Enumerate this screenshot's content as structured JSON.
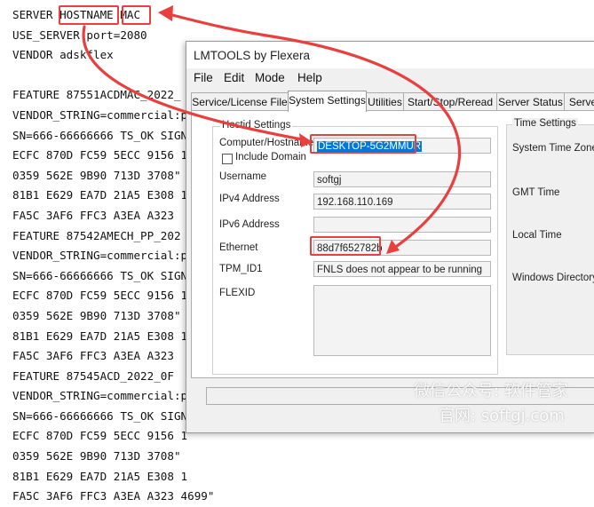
{
  "license_lines": [
    "SERVER HOSTNAME MAC",
    "USE_SERVER port=2080",
    "VENDOR adskflex",
    "",
    "FEATURE 87551ACDMAC_2022_",
    "VENDOR_STRING=commercial:p",
    "SN=666-66666666 TS_OK SIGN",
    "ECFC 870D FC59 5ECC 9156 1",
    "0359 562E 9B90 713D 3708\" ",
    "81B1 E629 EA7D 21A5 E308 1",
    "FA5C 3AF6 FFC3 A3EA A323 ",
    "FEATURE 87542AMECH_PP_202",
    "VENDOR_STRING=commercial:p",
    "SN=666-66666666 TS_OK SIGN",
    "ECFC 870D FC59 5ECC 9156 1",
    "0359 562E 9B90 713D 3708\" ",
    "81B1 E629 EA7D 21A5 E308 1",
    "FA5C 3AF6 FFC3 A3EA A323 ",
    "FEATURE 87545ACD_2022_0F",
    "VENDOR_STRING=commercial:p",
    "SN=666-66666666 TS_OK SIGN",
    "ECFC 870D FC59 5ECC 9156 1",
    "0359 562E 9B90 713D 3708\" ",
    "81B1 E629 EA7D 21A5 E308 1",
    "FA5C 3AF6 FFC3 A3EA A323 4699\""
  ],
  "window": {
    "title": "LMTOOLS by Flexera",
    "menu": [
      "File",
      "Edit",
      "Mode",
      "Help"
    ],
    "tabs": [
      "Service/License File",
      "System Settings",
      "Utilities",
      "Start/Stop/Reread",
      "Server Status",
      "Server"
    ],
    "active_tab": "System Settings"
  },
  "hostid": {
    "group_label": "Hostid Settings",
    "computer_label": "Computer/Hostname",
    "computer_value": "DESKTOP-5G2MMUR",
    "include_domain_label": "Include Domain",
    "username_label": "Username",
    "username_value": "softgj",
    "ipv4_label": "IPv4 Address",
    "ipv4_value": "192.168.110.169",
    "ipv6_label": "IPv6 Address",
    "ipv6_value": "",
    "ethernet_label": "Ethernet",
    "ethernet_value": "88d7f652782b",
    "tpm_label": "TPM_ID1",
    "tpm_value": "FNLS does not appear to be running",
    "flexid_label": "FLEXID"
  },
  "time_settings": {
    "group_label": "Time Settings",
    "system_tz_label": "System Time Zone",
    "gmt_label": "GMT Time",
    "local_label": "Local Time",
    "windir_label": "Windows Directory"
  },
  "watermark": {
    "line1": "微信公众号: 软件管家",
    "line2": "官网: softgj.com"
  },
  "colors": {
    "highlight": "#e8403f",
    "selection": "#0078d7"
  }
}
